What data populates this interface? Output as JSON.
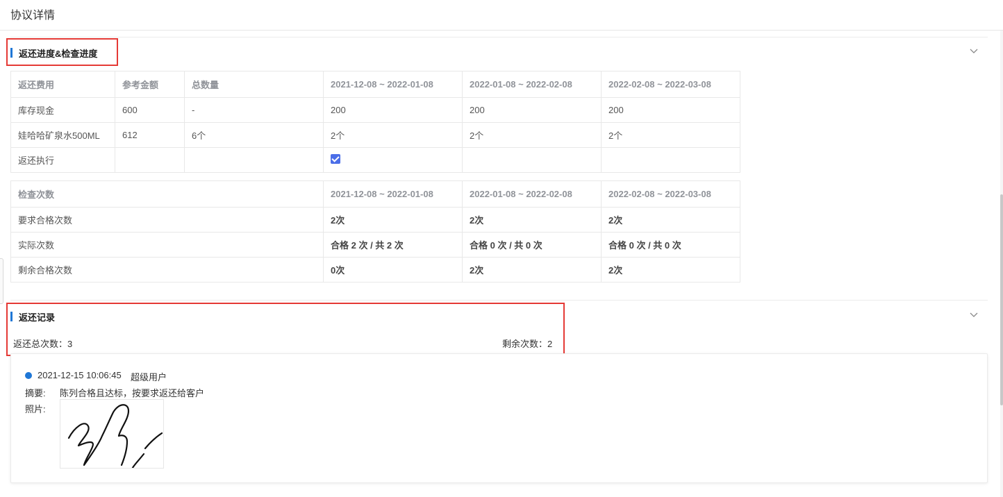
{
  "header": {
    "title": "协议详情"
  },
  "progress_section": {
    "title": "返还进度&检查进度",
    "return_table": {
      "headers": [
        "返还费用",
        "参考金额",
        "总数量",
        "2021-12-08 ~ 2022-01-08",
        "2022-01-08 ~ 2022-02-08",
        "2022-02-08 ~ 2022-03-08"
      ],
      "rows": [
        [
          "库存现金",
          "600",
          "-",
          "200",
          "200",
          "200"
        ],
        [
          "娃哈哈矿泉水500ML",
          "612",
          "6个",
          "2个",
          "2个",
          "2个"
        ],
        [
          "返还执行",
          "",
          "",
          "",
          "",
          ""
        ]
      ],
      "executed_checked": [
        true,
        false,
        false
      ]
    },
    "check_table": {
      "headers": [
        "检查次数",
        "2021-12-08 ~ 2022-01-08",
        "2022-01-08 ~ 2022-02-08",
        "2022-02-08 ~ 2022-03-08"
      ],
      "rows": [
        [
          "要求合格次数",
          "2次",
          "2次",
          "2次"
        ],
        [
          "实际次数",
          "合格 2 次 / 共 2 次",
          "合格 0 次 / 共 0 次",
          "合格 0 次 / 共 0 次"
        ],
        [
          "剩余合格次数",
          "0次",
          "2次",
          "2次"
        ]
      ]
    }
  },
  "records_section": {
    "title": "返还记录",
    "total_label": "返还总次数：3",
    "remaining_label": "剩余次数：2",
    "records": [
      {
        "datetime": "2021-12-15 10:06:45",
        "user": "超级用户",
        "summary_label": "摘要:",
        "summary": "陈列合格且达标，按要求返还给客户",
        "photo_label": "照片:"
      }
    ]
  },
  "colors": {
    "accent": "#1f77d6",
    "checkbox": "#4b6ee8",
    "highlight": "#e53935"
  }
}
